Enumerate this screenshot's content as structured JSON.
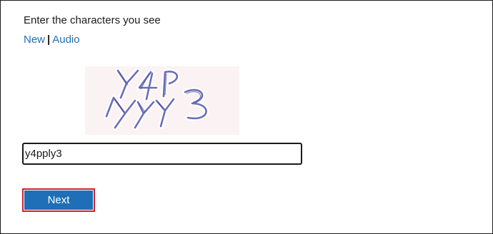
{
  "captcha": {
    "prompt": "Enter the characters you see",
    "new_link": "New",
    "separator": "|",
    "audio_link": "Audio",
    "image_text": "Y4P KKY3",
    "colors": {
      "ink": "#5a5fb0",
      "background": "#fbf3f3"
    }
  },
  "answer": {
    "value": "y4pply3"
  },
  "actions": {
    "next_label": "Next",
    "next_color": "#1f6fb8",
    "focus_outline_color": "#d41f2a"
  }
}
